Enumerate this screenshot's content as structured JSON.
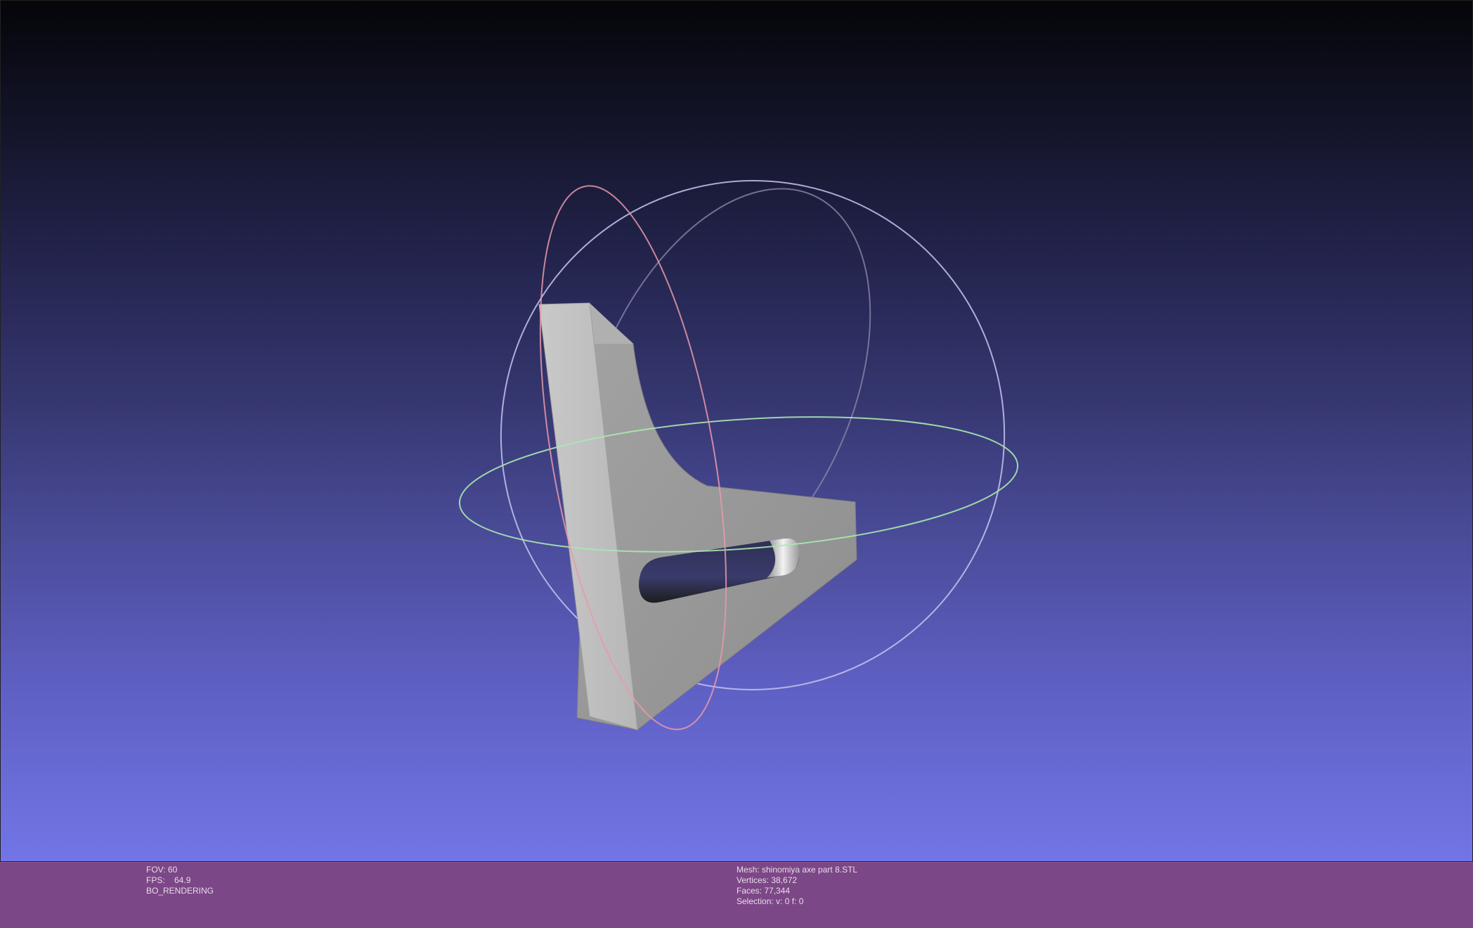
{
  "viewer": {
    "background_top": "#05050a",
    "background_bottom": "#7275e6",
    "mesh_color": "#a9a9a9",
    "trackball_colors": {
      "x_ring": "#e89aa8",
      "y_ring": "#9ee8a8",
      "z_ring": "#b9b9e8"
    }
  },
  "info_bar": {
    "background": "#7c4787",
    "left": {
      "fov": "FOV: 60",
      "fps": "FPS:    64.9",
      "mode": "BO_RENDERING"
    },
    "right": {
      "mesh": "Mesh: shinomiya axe part 8.STL",
      "vertices": "Vertices: 38,672",
      "faces": "Faces: 77,344",
      "selection": "Selection: v: 0 f: 0"
    }
  }
}
